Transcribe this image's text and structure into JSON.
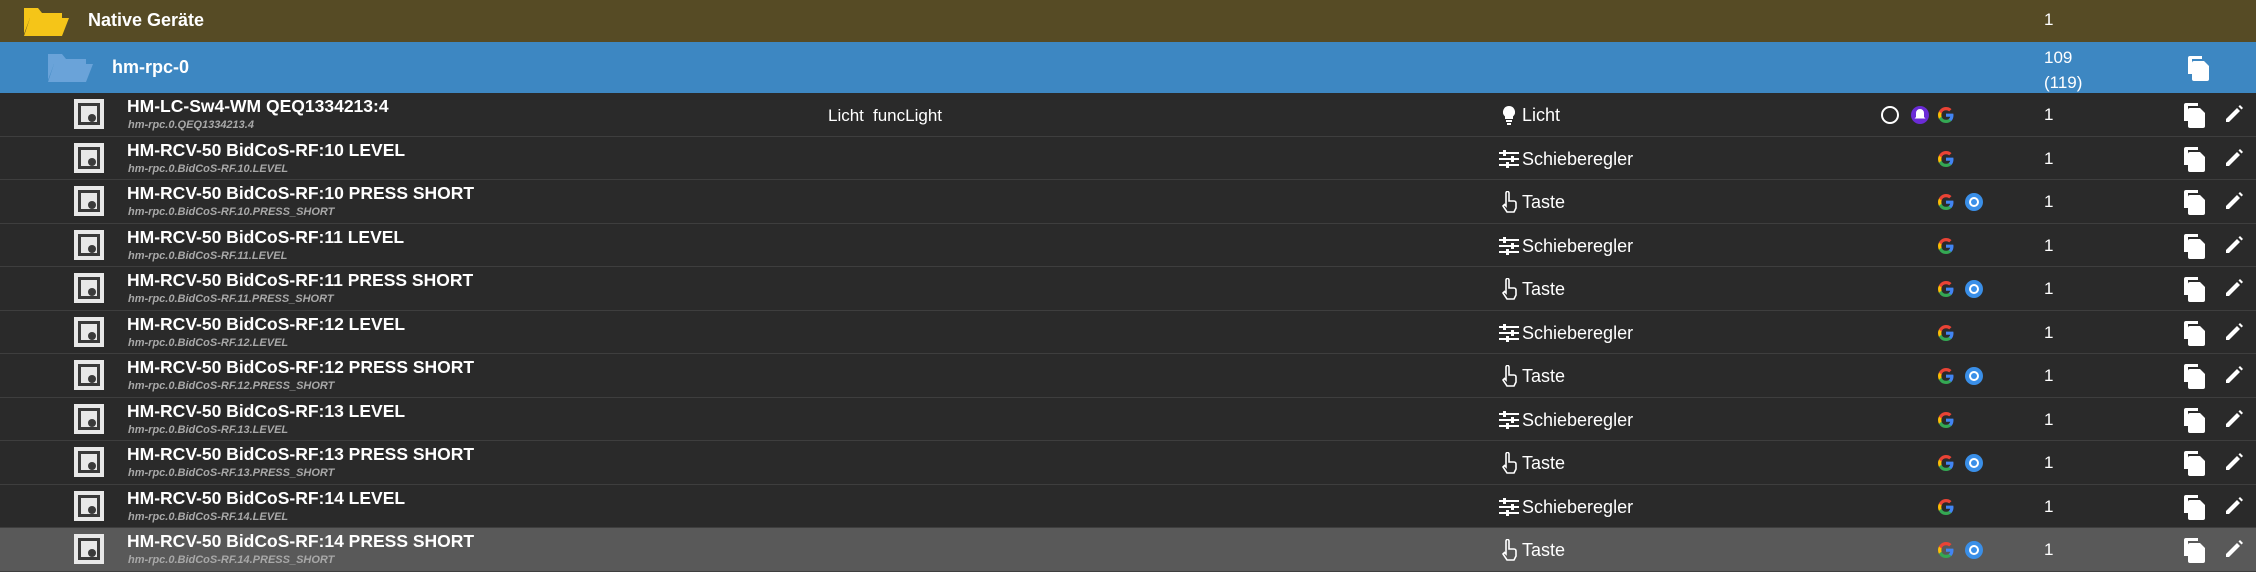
{
  "group": {
    "name": "Native Geräte",
    "count": "1"
  },
  "instance": {
    "name": "hm-rpc-0",
    "count": "109",
    "count_total": "(119)"
  },
  "colors": {
    "group_bg": "#564b25",
    "instance_bg": "#3d87c2",
    "folder_yellow": "#f5c518",
    "alexa": "#6b2bd6",
    "alisa": "#3a8fe8"
  },
  "icons": {
    "folder": "folder-open-icon",
    "device": "state-device-icon",
    "copy": "copy-icon",
    "edit": "pencil-icon",
    "light": "lightbulb-icon",
    "slider": "sliders-icon",
    "button": "hand-pointer-icon",
    "google": "google-icon",
    "alexa": "alexa-icon",
    "alisa": "alisa-icon"
  },
  "devices": [
    {
      "name": "HM-LC-Sw4-WM QEQ1334213:4",
      "id": "hm-rpc.0.QEQ1334213.4",
      "room": "Licht",
      "func": "funcLight",
      "type_icon": "light",
      "type": "Licht",
      "services": [
        "alexa-v3-circle",
        "alexa",
        "google"
      ],
      "count": "1"
    },
    {
      "name": "HM-RCV-50 BidCoS-RF:10 LEVEL",
      "id": "hm-rpc.0.BidCoS-RF.10.LEVEL",
      "room": "",
      "func": "",
      "type_icon": "slider",
      "type": "Schieberegler",
      "services": [
        "google"
      ],
      "count": "1"
    },
    {
      "name": "HM-RCV-50 BidCoS-RF:10 PRESS SHORT",
      "id": "hm-rpc.0.BidCoS-RF.10.PRESS_SHORT",
      "room": "",
      "func": "",
      "type_icon": "button",
      "type": "Taste",
      "services": [
        "google",
        "alisa"
      ],
      "count": "1"
    },
    {
      "name": "HM-RCV-50 BidCoS-RF:11 LEVEL",
      "id": "hm-rpc.0.BidCoS-RF.11.LEVEL",
      "room": "",
      "func": "",
      "type_icon": "slider",
      "type": "Schieberegler",
      "services": [
        "google"
      ],
      "count": "1"
    },
    {
      "name": "HM-RCV-50 BidCoS-RF:11 PRESS SHORT",
      "id": "hm-rpc.0.BidCoS-RF.11.PRESS_SHORT",
      "room": "",
      "func": "",
      "type_icon": "button",
      "type": "Taste",
      "services": [
        "google",
        "alisa"
      ],
      "count": "1"
    },
    {
      "name": "HM-RCV-50 BidCoS-RF:12 LEVEL",
      "id": "hm-rpc.0.BidCoS-RF.12.LEVEL",
      "room": "",
      "func": "",
      "type_icon": "slider",
      "type": "Schieberegler",
      "services": [
        "google"
      ],
      "count": "1"
    },
    {
      "name": "HM-RCV-50 BidCoS-RF:12 PRESS SHORT",
      "id": "hm-rpc.0.BidCoS-RF.12.PRESS_SHORT",
      "room": "",
      "func": "",
      "type_icon": "button",
      "type": "Taste",
      "services": [
        "google",
        "alisa"
      ],
      "count": "1"
    },
    {
      "name": "HM-RCV-50 BidCoS-RF:13 LEVEL",
      "id": "hm-rpc.0.BidCoS-RF.13.LEVEL",
      "room": "",
      "func": "",
      "type_icon": "slider",
      "type": "Schieberegler",
      "services": [
        "google"
      ],
      "count": "1"
    },
    {
      "name": "HM-RCV-50 BidCoS-RF:13 PRESS SHORT",
      "id": "hm-rpc.0.BidCoS-RF.13.PRESS_SHORT",
      "room": "",
      "func": "",
      "type_icon": "button",
      "type": "Taste",
      "services": [
        "google",
        "alisa"
      ],
      "count": "1"
    },
    {
      "name": "HM-RCV-50 BidCoS-RF:14 LEVEL",
      "id": "hm-rpc.0.BidCoS-RF.14.LEVEL",
      "room": "",
      "func": "",
      "type_icon": "slider",
      "type": "Schieberegler",
      "services": [
        "google"
      ],
      "count": "1"
    },
    {
      "name": "HM-RCV-50 BidCoS-RF:14 PRESS SHORT",
      "id": "hm-rpc.0.BidCoS-RF.14.PRESS_SHORT",
      "room": "",
      "func": "",
      "type_icon": "button",
      "type": "Taste",
      "services": [
        "google",
        "alisa"
      ],
      "count": "1",
      "highlighted": true
    }
  ]
}
